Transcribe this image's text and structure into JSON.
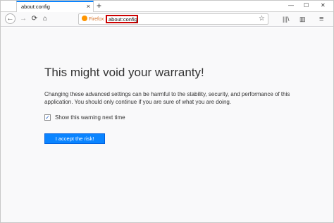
{
  "tab": {
    "title": "about:config",
    "close_glyph": "×",
    "new_tab_glyph": "+"
  },
  "window_controls": {
    "minimize": "—",
    "maximize": "☐",
    "close": "✕"
  },
  "toolbar": {
    "back_glyph": "←",
    "forward_glyph": "→",
    "reload_glyph": "⟳",
    "home_glyph": "⌂",
    "identity_label": "Firefox",
    "url_value": "about:config",
    "bookmark_glyph": "☆",
    "library_glyph": "|||\\",
    "sidebar_glyph": "▥",
    "menu_glyph": "≡"
  },
  "page": {
    "title": "This might void your warranty!",
    "description": "Changing these advanced settings can be harmful to the stability, security, and performance of this application. You should only continue if you are sure of what you are doing.",
    "checkbox_label": "Show this warning next time",
    "checkbox_checked": true,
    "checkbox_glyph": "✓",
    "accept_label": "I accept the risk!"
  },
  "colors": {
    "accent": "#0a84ff",
    "highlight_border": "#cc0000",
    "page_bg": "#f9f9fa"
  }
}
